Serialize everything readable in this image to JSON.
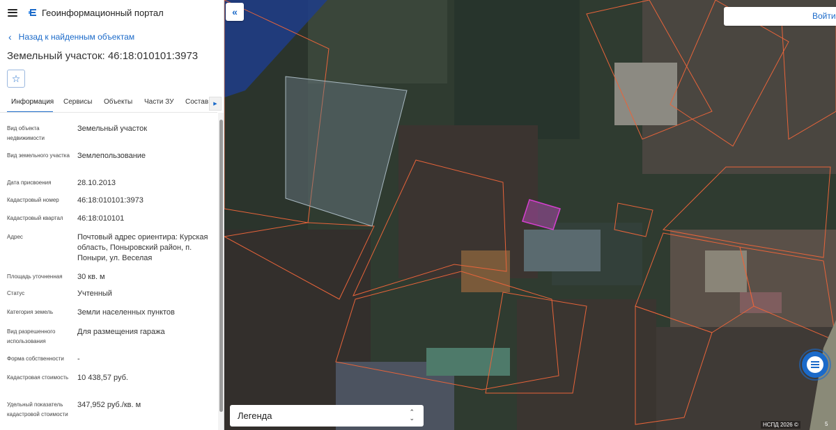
{
  "app": {
    "title": "Геоинформационный портал"
  },
  "nav": {
    "back_label": "Назад к найденным объектам"
  },
  "object": {
    "title": "Земельный участок: 46:18:010101:3973"
  },
  "tabs": [
    {
      "label": "Информация",
      "active": true
    },
    {
      "label": "Сервисы",
      "active": false
    },
    {
      "label": "Объекты",
      "active": false
    },
    {
      "label": "Части ЗУ",
      "active": false
    },
    {
      "label": "Состав",
      "active": false
    }
  ],
  "properties": [
    {
      "label": "Вид объекта недвижимости",
      "value": "Земельный участок"
    },
    {
      "label": "Вид земельного участка",
      "value": "Землепользование"
    },
    {
      "label": "Дата присвоения",
      "value": "28.10.2013"
    },
    {
      "label": "Кадастровый номер",
      "value": "46:18:010101:3973"
    },
    {
      "label": "Кадастровый квартал",
      "value": "46:18:010101"
    },
    {
      "label": "Адрес",
      "value": "Почтовый адрес ориентира: Курская область, Поныровский район, п. Поныри, ул. Веселая"
    },
    {
      "label": "Площадь уточненная",
      "value": "30 кв. м"
    },
    {
      "label": "Статус",
      "value": "Учтенный"
    },
    {
      "label": "Категория земель",
      "value": "Земли населенных пунктов"
    },
    {
      "label": "Вид разрешенного использования",
      "value": "Для размещения гаража"
    },
    {
      "label": "Форма собственности",
      "value": "-"
    },
    {
      "label": "Кадастровая стоимость",
      "value": "10 438,57 руб."
    },
    {
      "label": "Удельный показатель кадастровой стоимости",
      "value": "347,952 руб./кв. м"
    }
  ],
  "map": {
    "login_label": "Войти",
    "legend_label": "Легенда",
    "copyright": "НСПД 2026 ©",
    "scale": "5",
    "parcel_outline_color": "#e8643a",
    "selected_parcel_color": "#d63fd0",
    "quarter_fill_color": "#1f3d8a"
  },
  "icons": {
    "menu": "burger-menu-icon",
    "logo": "portal-logo-icon",
    "back": "chevron-left-icon",
    "favorite": "star-icon",
    "collapse": "double-chevron-left-icon",
    "chat": "chat-bubble-icon"
  }
}
